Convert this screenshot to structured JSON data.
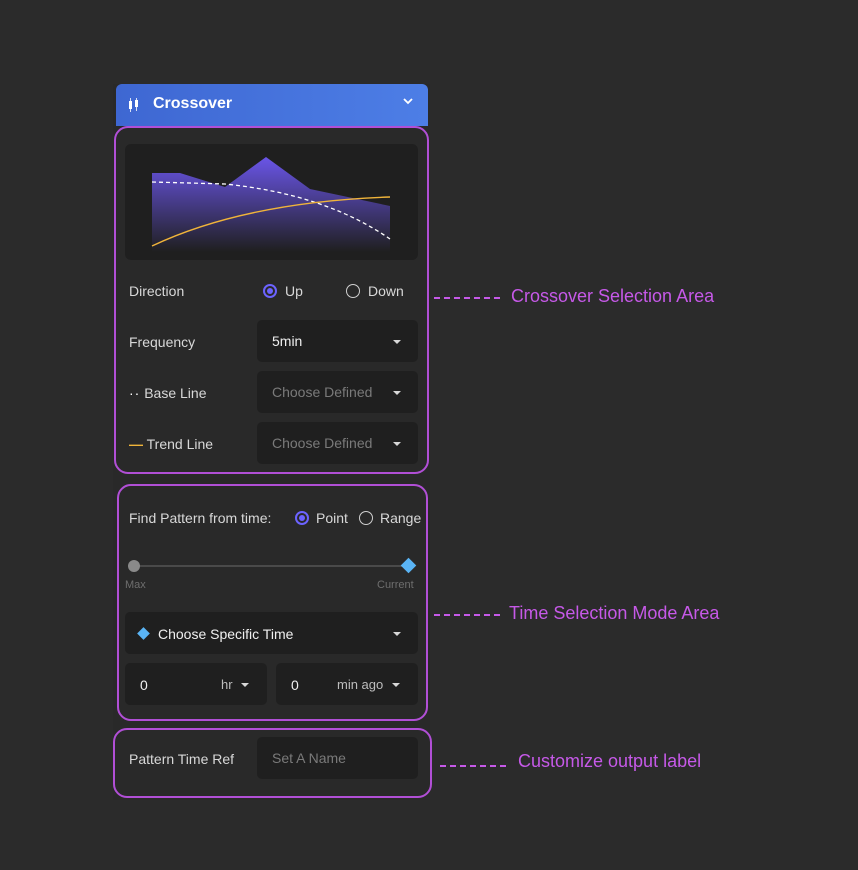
{
  "header": {
    "title": "Crossover",
    "icon": "candlestick-icon",
    "chevron": "chevron-down-icon"
  },
  "crossover": {
    "direction": {
      "label": "Direction",
      "options": [
        "Up",
        "Down"
      ],
      "selected": "Up"
    },
    "frequency": {
      "label": "Frequency",
      "value": "5min"
    },
    "base_line": {
      "label": "Base Line",
      "marker": "··",
      "placeholder": "Choose Defined"
    },
    "trend_line": {
      "label": "Trend Line",
      "marker": "—",
      "placeholder": "Choose Defined"
    }
  },
  "time_selection": {
    "label": "Find Pattern from time:",
    "options": [
      "Point",
      "Range"
    ],
    "selected": "Point",
    "slider": {
      "min_label": "Max",
      "max_label": "Current",
      "value": 1.0
    },
    "specific_time": "Choose Specific Time",
    "hours": {
      "value": "0",
      "unit": "hr"
    },
    "minutes": {
      "value": "0",
      "unit": "min ago"
    }
  },
  "output": {
    "label": "Pattern Time Ref",
    "placeholder": "Set A Name"
  },
  "annotations": {
    "crossover_area": "Crossover Selection Area",
    "time_area": "Time Selection Mode Area",
    "output_area": "Customize output label"
  },
  "colors": {
    "header_start": "#3e67d2",
    "header_end": "#4d7ee6",
    "accent": "#6c63ff",
    "outline": "#b14fd6",
    "trend": "#f0b43a",
    "diamond": "#5ab4f5"
  }
}
